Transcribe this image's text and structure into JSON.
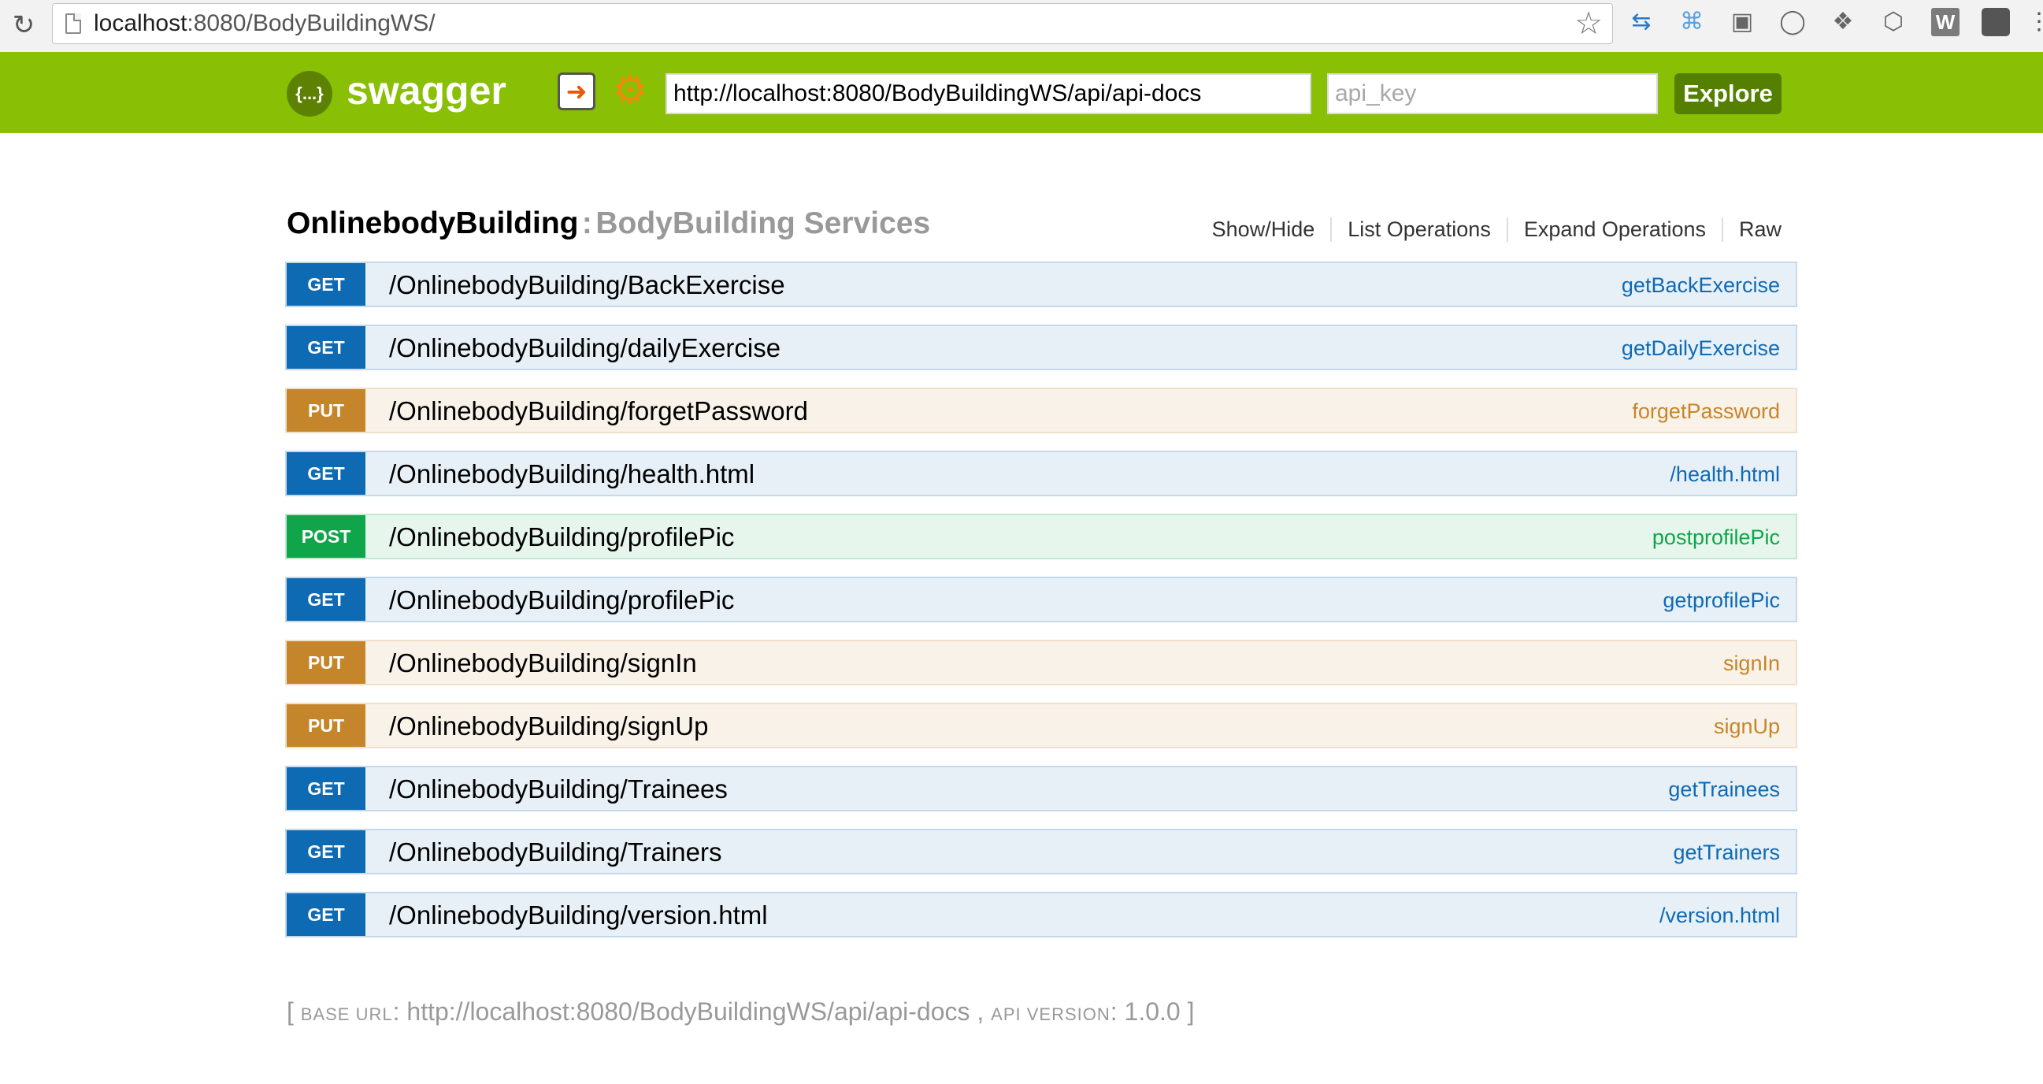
{
  "browser": {
    "url_host": "localhost",
    "url_rest": ":8080/BodyBuildingWS/"
  },
  "swagger": {
    "logo_text": "{...}",
    "title": "swagger",
    "api_url": "http://localhost:8080/BodyBuildingWS/api/api-docs",
    "api_key_placeholder": "api_key",
    "explore_label": "Explore"
  },
  "resource": {
    "name": "OnlinebodyBuilding",
    "separator": ":",
    "description": "BodyBuilding Services",
    "links": [
      "Show/Hide",
      "List Operations",
      "Expand Operations",
      "Raw"
    ]
  },
  "operations": [
    {
      "method": "GET",
      "path": "/OnlinebodyBuilding/BackExercise",
      "nickname": "getBackExercise"
    },
    {
      "method": "GET",
      "path": "/OnlinebodyBuilding/dailyExercise",
      "nickname": "getDailyExercise"
    },
    {
      "method": "PUT",
      "path": "/OnlinebodyBuilding/forgetPassword",
      "nickname": "forgetPassword"
    },
    {
      "method": "GET",
      "path": "/OnlinebodyBuilding/health.html",
      "nickname": "/health.html"
    },
    {
      "method": "POST",
      "path": "/OnlinebodyBuilding/profilePic",
      "nickname": "postprofilePic"
    },
    {
      "method": "GET",
      "path": "/OnlinebodyBuilding/profilePic",
      "nickname": "getprofilePic"
    },
    {
      "method": "PUT",
      "path": "/OnlinebodyBuilding/signIn",
      "nickname": "signIn"
    },
    {
      "method": "PUT",
      "path": "/OnlinebodyBuilding/signUp",
      "nickname": "signUp"
    },
    {
      "method": "GET",
      "path": "/OnlinebodyBuilding/Trainees",
      "nickname": "getTrainees"
    },
    {
      "method": "GET",
      "path": "/OnlinebodyBuilding/Trainers",
      "nickname": "getTrainers"
    },
    {
      "method": "GET",
      "path": "/OnlinebodyBuilding/version.html",
      "nickname": "/version.html"
    }
  ],
  "footer": {
    "open": "[",
    "base_url_label": "base url",
    "base_url": "http://localhost:8080/BodyBuildingWS/api/api-docs",
    "api_version_label": "api version",
    "api_version": "1.0.0",
    "close": "]"
  },
  "icons": [
    "reload-icon",
    "page-icon",
    "bookmark-star-icon",
    "sync-icon",
    "command-icon",
    "cast-icon",
    "circle-icon",
    "dropbox-icon",
    "cube-icon",
    "w-extension-icon",
    "speech-extension-icon",
    "wrench-icon",
    "gear-icon"
  ]
}
